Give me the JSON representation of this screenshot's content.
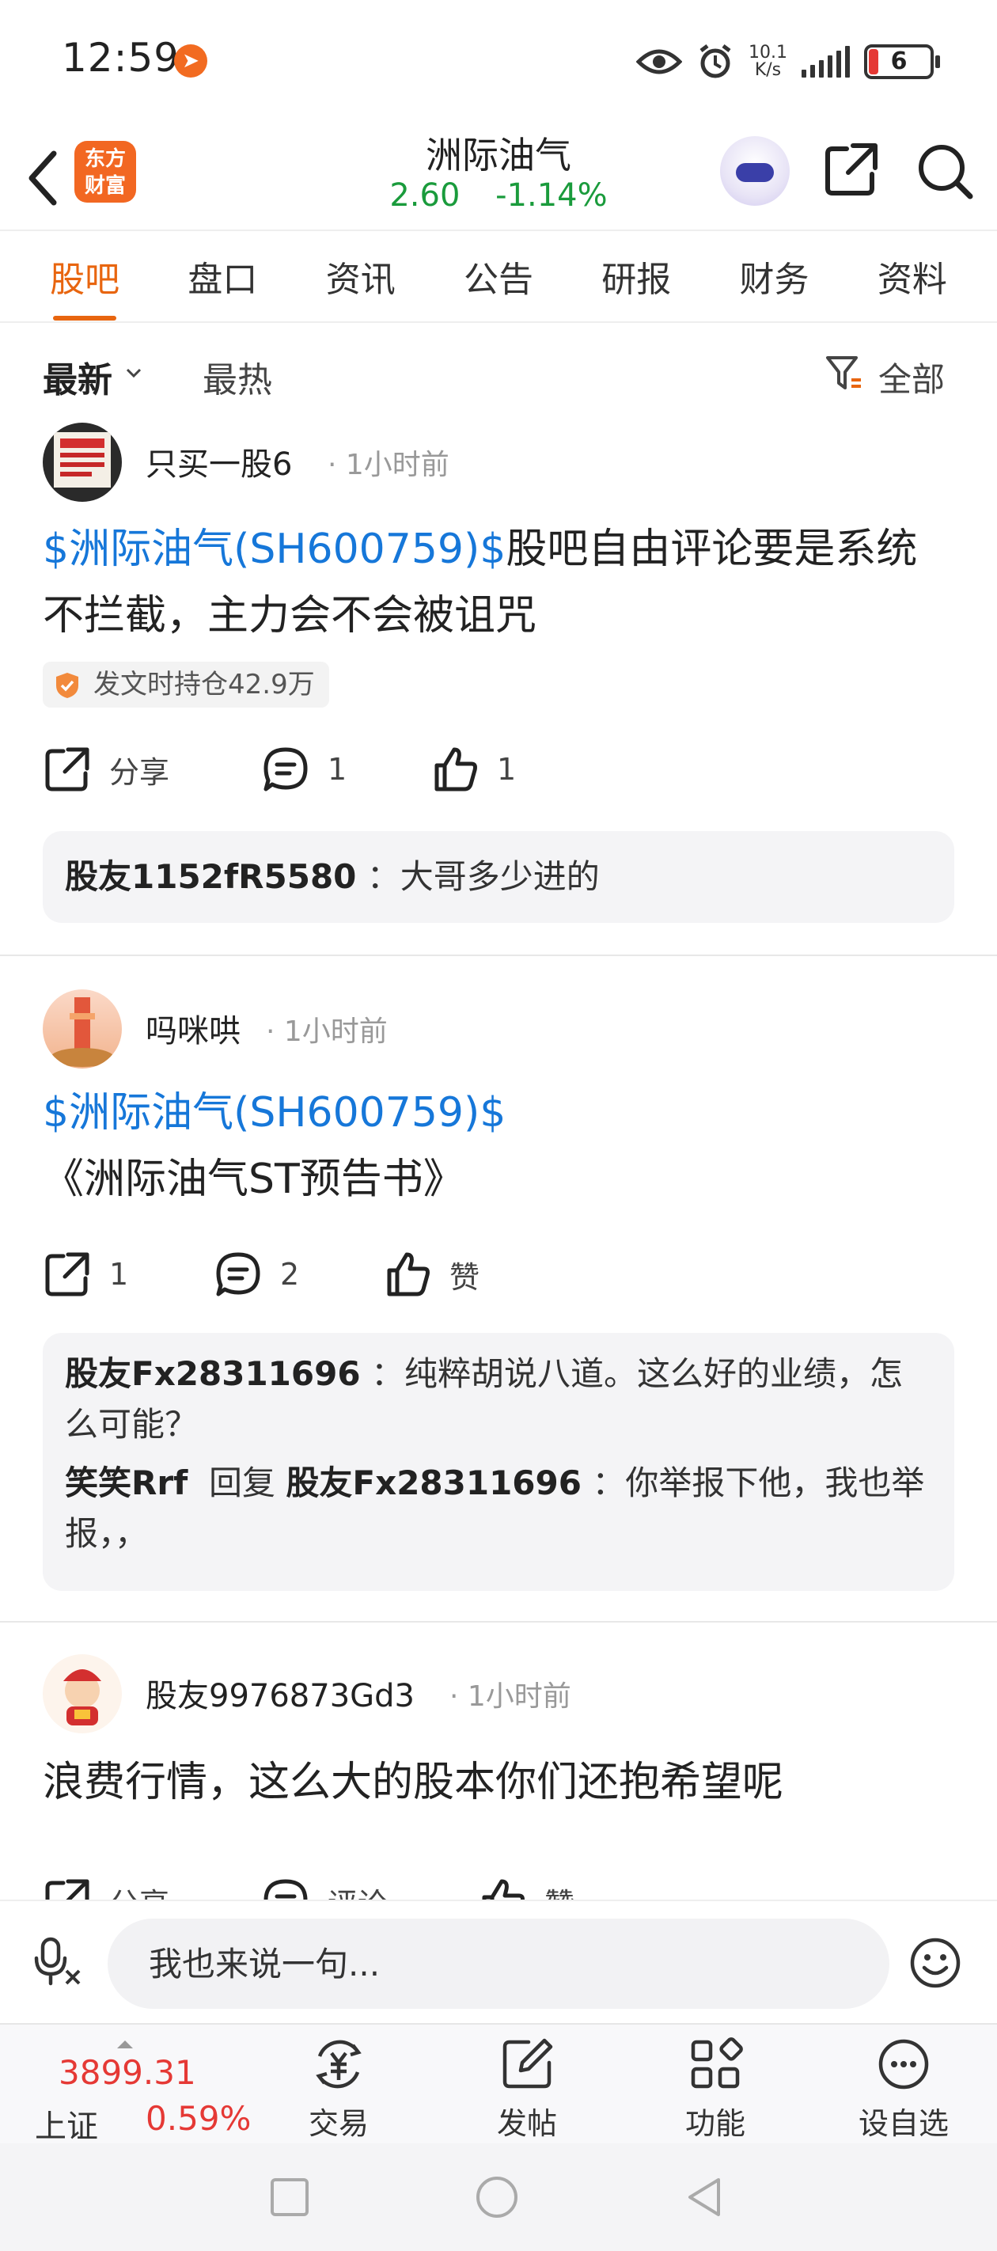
{
  "status_bar": {
    "time": "12:59",
    "net_speed_value": "10.1",
    "net_speed_unit": "K/s",
    "battery": "6"
  },
  "header": {
    "app_logo_line1": "东方",
    "app_logo_line2": "财富",
    "stock_name": "洲际油气",
    "price": "2.60",
    "change_pct": "-1.14%",
    "quote_color": "#1a9b3c"
  },
  "tabs": [
    {
      "label": "股吧",
      "active": true
    },
    {
      "label": "盘口"
    },
    {
      "label": "资讯"
    },
    {
      "label": "公告"
    },
    {
      "label": "研报"
    },
    {
      "label": "财务"
    },
    {
      "label": "资料"
    }
  ],
  "filter": {
    "latest": "最新",
    "hot": "最热",
    "all": "全部"
  },
  "posts": [
    {
      "author": "只买一股6",
      "time": "1小时前",
      "stock_tag": "$洲际油气(SH600759)$",
      "text": "股吧自由评论要是系统不拦截，主力会不会被诅咒",
      "hold_badge": "发文时持仓42.9万",
      "share_label": "分享",
      "comment_count": "1",
      "like_count": "1",
      "comments": [
        {
          "user": "股友1152fR5580",
          "text": "：大哥多少进的"
        }
      ]
    },
    {
      "author": "吗咪哄",
      "time": "1小时前",
      "stock_tag": "$洲际油气(SH600759)$",
      "text": "《洲际油气ST预告书》",
      "share_label": "1",
      "comment_count": "2",
      "like_label": "赞",
      "comments": [
        {
          "user": "股友Fx28311696",
          "text": "：纯粹胡说八道。这么好的业绩，怎么可能？"
        },
        {
          "user": "笑笑Rrf",
          "reply_word": "回复",
          "reply_to": "股友Fx28311696",
          "text": "：你举报下他，我也举报，，"
        }
      ]
    },
    {
      "author": "股友9976873Gd3",
      "time": "1小时前",
      "text": "浪费行情，这么大的股本你们还抱希望呢",
      "share_label": "分享",
      "comment_label": "评论",
      "like_label": "赞"
    }
  ],
  "input_bar": {
    "placeholder": "我也来说一句..."
  },
  "bottom_nav": {
    "index_value": "3899.31",
    "index_name": "上证",
    "index_pct": "0.59%",
    "index_color": "#e53935",
    "items": [
      {
        "label": "交易",
        "icon": "trade-icon"
      },
      {
        "label": "发帖",
        "icon": "compose-icon"
      },
      {
        "label": "功能",
        "icon": "apps-icon"
      },
      {
        "label": "设自选",
        "icon": "more-icon"
      }
    ]
  },
  "accent_color": "#e8650f",
  "link_color": "#1677d9"
}
